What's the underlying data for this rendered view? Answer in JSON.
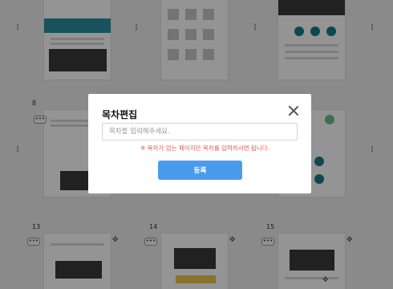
{
  "pages": {
    "numbers": [
      "8",
      "13",
      "14",
      "15"
    ],
    "menu_glyph": "•••",
    "move_glyph": "✥"
  },
  "modal": {
    "title": "목차편집",
    "input_placeholder": "목차를 입력해주세요.",
    "input_value": "",
    "notice": "※ 목차가 있는 페이지만 목차를 입력하시면 됩니다.",
    "submit_label": "등록"
  },
  "colors": {
    "accent": "#4a9bf0",
    "notice": "#e05a5a",
    "overlay": "rgba(0,0,0,0.42)"
  }
}
